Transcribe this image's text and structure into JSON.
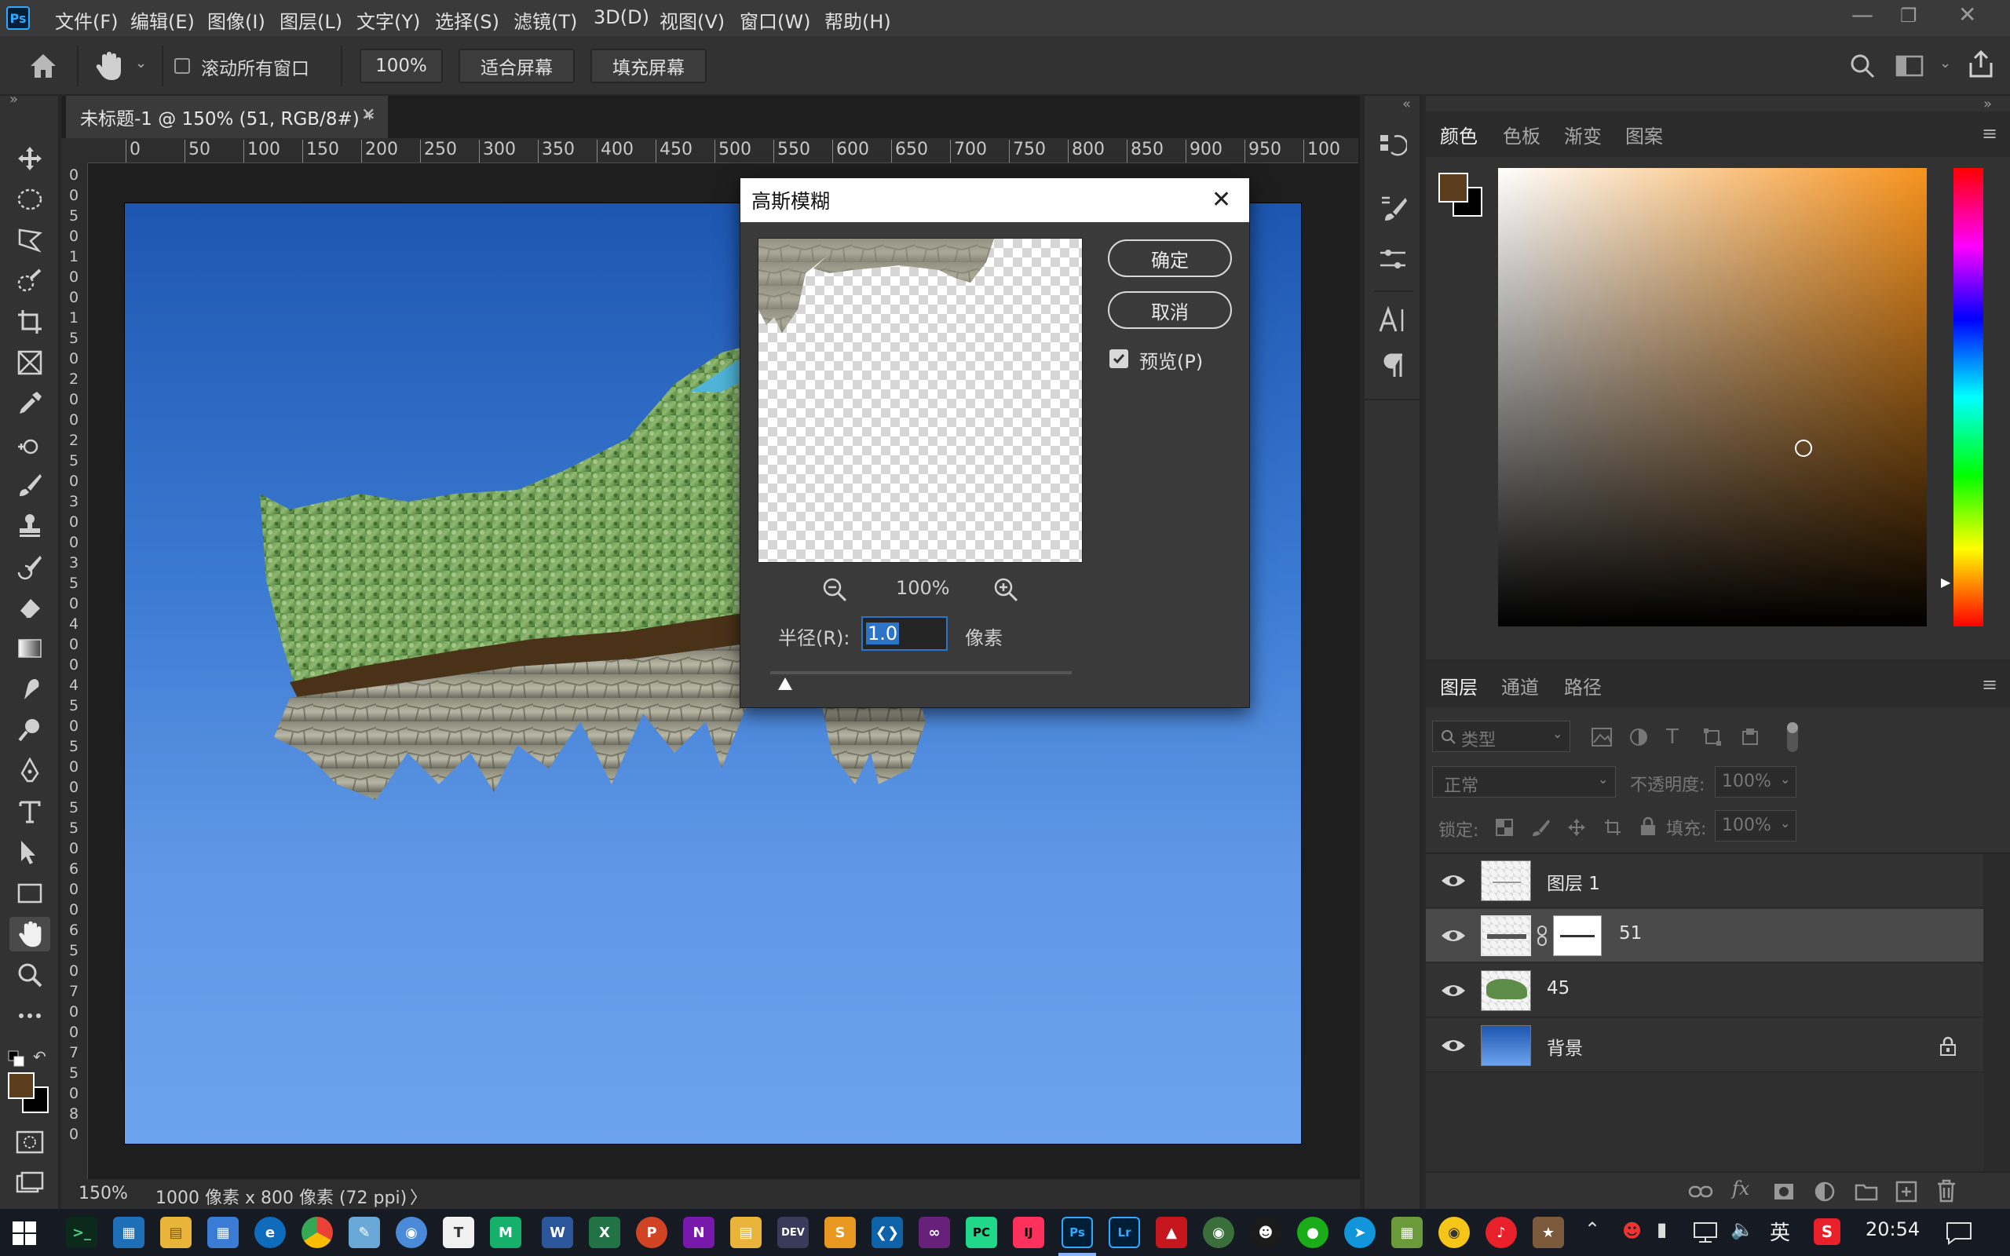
{
  "app": {
    "icon_label": "Ps"
  },
  "menu": [
    "文件(F)",
    "编辑(E)",
    "图像(I)",
    "图层(L)",
    "文字(Y)",
    "选择(S)",
    "滤镜(T)",
    "3D(D)",
    "视图(V)",
    "窗口(W)",
    "帮助(H)"
  ],
  "options_bar": {
    "scroll_all_windows": "滚动所有窗口",
    "zoom_value": "100%",
    "fit_screen": "适合屏幕",
    "fill_screen": "填充屏幕"
  },
  "document": {
    "tab_title": "未标题-1 @ 150% (51, RGB/8#) *",
    "ruler_h": [
      "0",
      "50",
      "100",
      "150",
      "200",
      "250",
      "300",
      "350",
      "400",
      "450",
      "500",
      "550",
      "600",
      "650",
      "700",
      "750",
      "800",
      "850",
      "900",
      "950",
      "100"
    ],
    "ruler_v": [
      "0",
      "0",
      "5",
      "0",
      "1",
      "0",
      "0",
      "1",
      "5",
      "0",
      "2",
      "0",
      "0",
      "2",
      "5",
      "0",
      "3",
      "0",
      "0",
      "3",
      "5",
      "0",
      "4",
      "0",
      "0",
      "4",
      "5",
      "0",
      "5",
      "0",
      "0",
      "5",
      "5",
      "0",
      "6",
      "0",
      "0",
      "6",
      "5",
      "0",
      "7",
      "0",
      "0",
      "7",
      "5",
      "0",
      "8",
      "0"
    ],
    "zoom": "150%",
    "info": "1000 像素 x 800 像素 (72 ppi)",
    "info_arrow": "〉"
  },
  "dialog": {
    "title": "高斯模糊",
    "ok": "确定",
    "cancel": "取消",
    "preview_label": "预览(P)",
    "preview_checked": true,
    "preview_zoom": "100%",
    "radius_label": "半径(R):",
    "radius_value": "1.0",
    "radius_unit": "像素",
    "radius_slider": 0.05
  },
  "color_panel": {
    "tabs": [
      "颜色",
      "色板",
      "渐变",
      "图案"
    ],
    "active_tab": "颜色",
    "foreground": "#5c3d1e",
    "background": "#000000",
    "hue_color": "#f7931e"
  },
  "layers_panel": {
    "tabs": [
      "图层",
      "通道",
      "路径"
    ],
    "active_tab": "图层",
    "filter_placeholder": "类型",
    "blend_mode": "正常",
    "opacity_label": "不透明度:",
    "opacity_value": "100%",
    "lock_label": "锁定:",
    "fill_label": "填充:",
    "fill_value": "100%",
    "layers": [
      {
        "name": "图层 1",
        "selected": false,
        "locked": false
      },
      {
        "name": "51",
        "selected": true,
        "locked": false
      },
      {
        "name": "45",
        "selected": false,
        "locked": false
      },
      {
        "name": "背景",
        "selected": false,
        "locked": true
      }
    ]
  },
  "taskbar": {
    "time": "20:54",
    "ime": "英"
  }
}
